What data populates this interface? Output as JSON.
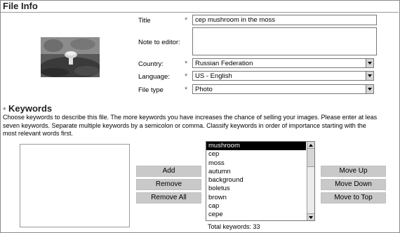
{
  "file_info": {
    "heading": "File Info",
    "title_label": "Title",
    "title_value": "cep mushroom in the moss",
    "note_label": "Note to editor:",
    "country_label": "Country:",
    "country_value": "Russian Federation",
    "language_label": "Language:",
    "language_value": "US - English",
    "filetype_label": "File type",
    "filetype_value": "Photo",
    "required_marker": "*"
  },
  "keywords": {
    "heading": "Keywords",
    "description_lines": [
      "Choose keywords to describe this file. The more keywords you have increases the chance of selling your images. Please enter at leas",
      "seven keywords. Separate multiple keywords by a semicolon or comma. Classify keywords in order of importance starting with the",
      "most relevant words first."
    ],
    "buttons": {
      "add": "Add",
      "remove": "Remove",
      "remove_all": "Remove All",
      "move_up": "Move Up",
      "move_down": "Move Down",
      "move_to_top": "Move to Top"
    },
    "list": [
      "mushroom",
      "cep",
      "moss",
      "autumn",
      "background",
      "boletus",
      "brown",
      "cap",
      "cepe"
    ],
    "selected_index": 0,
    "total_label": "Total keywords: 33"
  }
}
